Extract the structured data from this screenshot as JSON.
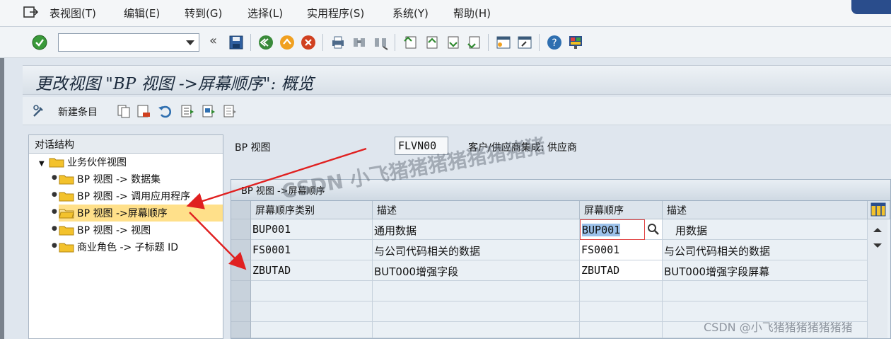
{
  "menu": {
    "items": [
      "表视图(T)",
      "编辑(E)",
      "转到(G)",
      "选择(L)",
      "实用程序(S)",
      "系统(Y)",
      "帮助(H)"
    ]
  },
  "toolbar": {
    "command_value": "",
    "chevron": "«"
  },
  "title": "更改视图 \"BP 视图 ->屏幕顺序\": 概览",
  "app_toolbar": {
    "new_entries": "新建条目"
  },
  "left_panel": {
    "header": "对话结构",
    "root": "业务伙伴视图",
    "items": [
      {
        "label": "BP 视图 -> 数据集"
      },
      {
        "label": "BP 视图 -> 调用应用程序"
      },
      {
        "label": "BP 视图 ->屏幕顺序"
      },
      {
        "label": "BP 视图 -> 视图"
      },
      {
        "label": "商业角色 -> 子标题 ID"
      }
    ]
  },
  "header_field": {
    "label": "BP 视图",
    "value": "FLVN00",
    "description": "客户/供应商集成: 供应商"
  },
  "table": {
    "caption": "BP 视图 ->屏幕顺序",
    "columns": [
      "屏幕顺序类别",
      "描述",
      "屏幕顺序",
      "描述"
    ],
    "rows": [
      [
        "BUP001",
        "通用数据",
        "BUP001",
        "用数据"
      ],
      [
        "FS0001",
        "与公司代码相关的数据",
        "FS0001",
        "与公司代码相关的数据"
      ],
      [
        "ZBUTAD",
        "BUT000增强字段",
        "ZBUTAD",
        "BUT000增强字段屏幕"
      ]
    ]
  },
  "watermark": "CSDN @小飞猪猪猪猪猪猪猪",
  "diag_watermark": "CSDN 小飞猪猪猪猪猪猪猪猪",
  "colors": {
    "accent_red": "#e02020",
    "selection": "#ffe08a",
    "folder": "#f3c22c"
  }
}
